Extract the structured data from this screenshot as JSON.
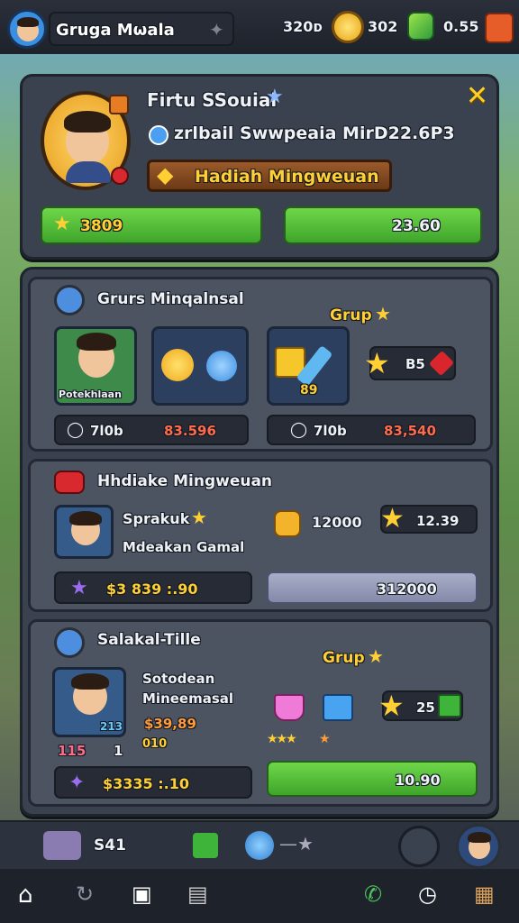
{
  "header": {
    "player_name": "Grugа Mωala",
    "currency1": "320ᴅ",
    "currency2": "302",
    "currency3": "0.55"
  },
  "profile": {
    "title": "Firtu SSouial",
    "subtitle": "zrlbail Swwpeaia MirD22.6P3",
    "reward_button": "Hadiah Mingweuan",
    "bar_left": "3809",
    "bar_right": "23.60"
  },
  "group_section": {
    "title": "Grurs Minqalnsal",
    "grup_label": "Grup",
    "avatar_caption": "Potekhlaan",
    "stat1_a": "7l0b",
    "stat1_b": "83.596",
    "stat2_a": "7l0b",
    "stat2_b": "83,540",
    "item_badge": "89",
    "gem_value": "B5"
  },
  "weekly_section": {
    "title": "Hhdiake Mingweuan",
    "player_name": "Sprakuk",
    "player_desc": "Mdeakan Gamal",
    "reward1": "12000",
    "reward2": "12.39",
    "bar_left": "$3 839 :.90",
    "bar_right": "312000"
  },
  "social_section": {
    "title": "Salakal-Tille",
    "grup_label": "Grup",
    "player_line1": "Sotodean",
    "player_line2": "Mineemasal",
    "money": "$39,89",
    "small_value": "010",
    "counter": "115",
    "counter2": "1",
    "badge": "213",
    "reward_count": "25",
    "bar_left": "$3335 :.10",
    "bar_right": "10.90"
  },
  "footer": {
    "value": "S41"
  }
}
